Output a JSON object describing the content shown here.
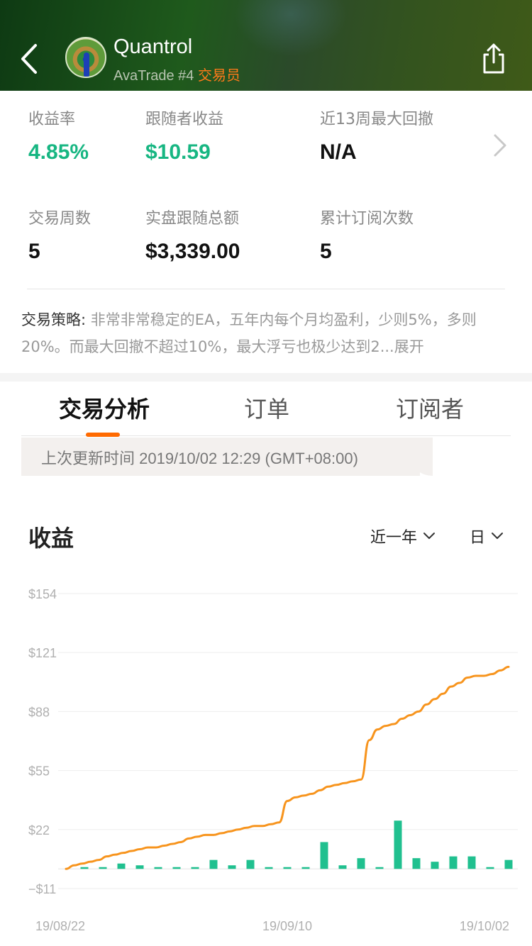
{
  "header": {
    "trader_name": "Quantrol",
    "broker_rank": "AvaTrade #4",
    "role": "交易员",
    "icons": [
      "back-arrow-icon",
      "share-icon"
    ]
  },
  "stats": {
    "return_rate": {
      "label": "收益率",
      "value": "4.85%"
    },
    "follower_profit": {
      "label": "跟随者收益",
      "value": "$10.59"
    },
    "max_drawdown": {
      "label": "近13周最大回撤",
      "value": "N/A"
    },
    "trading_weeks": {
      "label": "交易周数",
      "value": "5"
    },
    "live_follow_total": {
      "label": "实盘跟随总额",
      "value": "$3,339.00"
    },
    "subscriptions": {
      "label": "累计订阅次数",
      "value": "5"
    }
  },
  "strategy": {
    "label": "交易策略:",
    "text": " 非常非常稳定的EA，五年内每个月均盈利，少则5%，多则20%。而最大回撤不超过10%，最大浮亏也极少达到2...",
    "expand": "展开"
  },
  "tabs": [
    {
      "label": "交易分析",
      "active": true
    },
    {
      "label": "订单",
      "active": false
    },
    {
      "label": "订阅者",
      "active": false
    }
  ],
  "update": {
    "text": "上次更新时间 2019/10/02 12:29 (GMT+08:00)"
  },
  "chart_section": {
    "title": "收益",
    "range_select": "近一年",
    "period_select": "日"
  },
  "colors": {
    "accent": "#ff6a00",
    "green": "#17b682",
    "line": "#f7941d"
  },
  "chart_data": {
    "type": "line",
    "title": "",
    "y_ticks": [
      "$154",
      "$121",
      "$88",
      "$55",
      "$22",
      "−$11"
    ],
    "y_tick_values": [
      154,
      121,
      88,
      55,
      22,
      -11
    ],
    "x_tick_labels": [
      "19/08/22",
      "19/09/10",
      "19/10/02"
    ],
    "ylim": [
      -11,
      154
    ],
    "series": [
      {
        "type": "line",
        "values": [
          0,
          2,
          3,
          4,
          5,
          7,
          8,
          9,
          10,
          11,
          12,
          12,
          13,
          14,
          15,
          17,
          18,
          19,
          19,
          20,
          21,
          22,
          23,
          24,
          24,
          25,
          26,
          38,
          40,
          41,
          42,
          44,
          46,
          47,
          48,
          49,
          50,
          72,
          78,
          80,
          81,
          84,
          86,
          88,
          92,
          95,
          98,
          102,
          104,
          107,
          108,
          108,
          109,
          111,
          113
        ]
      },
      {
        "type": "bar",
        "values": [
          1,
          1,
          3,
          2,
          1,
          1,
          1,
          5,
          2,
          5,
          1,
          1,
          1,
          15,
          2,
          6,
          1,
          27,
          6,
          4,
          7,
          7,
          1,
          5
        ]
      }
    ],
    "grid": true
  }
}
